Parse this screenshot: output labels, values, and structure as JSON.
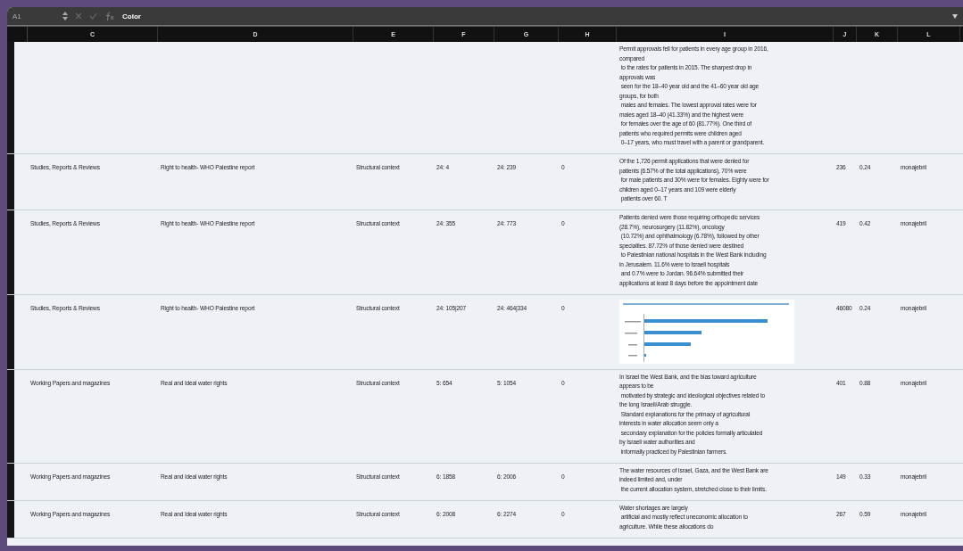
{
  "formula_bar": {
    "cell_ref": "A1",
    "formula": "Color"
  },
  "columns": [
    "C",
    "D",
    "E",
    "F",
    "G",
    "H",
    "I",
    "J",
    "K",
    "L"
  ],
  "rows": [
    {
      "kind": "text",
      "cells": {
        "I": "Permit approvals fell for patients in every age group in 2016,\ncompared\n to the rates for patients in 2015. The sharpest drop in\napprovals was\n seen for the 18–40 year old and the 41–60 year old age\ngroups, for both\n males and females. The lowest approval rates were for\nmales aged 18–40 (41.33%) and the highest were\n for females over the age of 60 (81.77%). One third of\npatients who required permits were children aged\n 0–17 years, who must travel with a parent or grandparent."
      }
    },
    {
      "kind": "text",
      "cells": {
        "C": "Studies, Reports & Reviews",
        "D": "Right to health- WHO Palestine report",
        "E": "Structural context",
        "F": "24: 4",
        "G": "24: 239",
        "H": "0",
        "I": "Of the 1,726 permit applications that were denied for\npatients (6.57% of the total applications), 70% were\n for male patients and 30% were for females. Eighty were for\nchildren aged 0–17 years and 109 were elderly\n patients over 60. T",
        "J": "236",
        "K": "0.24",
        "L": "monajebril"
      }
    },
    {
      "kind": "text",
      "cells": {
        "C": "Studies, Reports & Reviews",
        "D": "Right to health- WHO Palestine report",
        "E": "Structural context",
        "F": "24: 355",
        "G": "24: 773",
        "H": "0",
        "I": "Patients denied were those requiring orthopedic services\n(28.7%), neurosurgery (11.82%), oncology\n (10.72%) and ophthalmology (6.78%), followed by other\nspecialties. 87.72% of those denied were destined\n to Palestinian national hospitals in the West Bank including\nin Jerusalem. 11.6% were to Israeli hospitals\n and 0.7% were to Jordan. 96.64% submitted their\napplications at least 8 days before the appointment date",
        "J": "419",
        "K": "0.42",
        "L": "monajebril"
      }
    },
    {
      "kind": "chart",
      "cells": {
        "C": "Studies, Reports & Reviews",
        "D": "Right to health- WHO Palestine report",
        "E": "Structural context",
        "F": "24: 105|207",
        "G": "24: 464|334",
        "H": "0",
        "J": "46080",
        "K": "0.24",
        "L": "monajebril"
      }
    },
    {
      "kind": "text",
      "cells": {
        "C": "Working Papers and magazines",
        "D": "Real and Ideal water rights",
        "E": "Structural context",
        "F": "5: 654",
        "G": "5: 1054",
        "H": "0",
        "I": "In Israel the West Bank, and the bias toward agriculture\nappears to be\n motivated by strategic and ideological objectives related to\nthe long Israeli/Arab struggle.\n Standard explanations for the primacy of agricultural\ninterests in water allocation seem only a\n secondary explanation for the policies formally articulated\nby Israeli water authorities and\n informally practiced by Palestinian farmers.",
        "J": "401",
        "K": "0.88",
        "L": "monajebril"
      }
    },
    {
      "kind": "text",
      "cells": {
        "C": "Working Papers and magazines",
        "D": "Real and Ideal water rights",
        "E": "Structural context",
        "F": "6: 1858",
        "G": "6: 2006",
        "H": "0",
        "I": "The water resources of Israel, Gaza, and the West Bank are\nindeed limited and, under\n the current allocation system, stretched close to their limits.",
        "J": "149",
        "K": "0.33",
        "L": "monajebril"
      }
    },
    {
      "kind": "text",
      "cells": {
        "C": "Working Papers and magazines",
        "D": "Real and Ideal water rights",
        "E": "Structural context",
        "F": "6: 2008",
        "G": "6: 2274",
        "H": "0",
        "I": "Water shortages are largely\n artificial and mostly reflect uneconomic allocation to\nagriculture. While these allocations do",
        "J": "267",
        "K": "0.59",
        "L": "monajebril"
      }
    }
  ]
}
